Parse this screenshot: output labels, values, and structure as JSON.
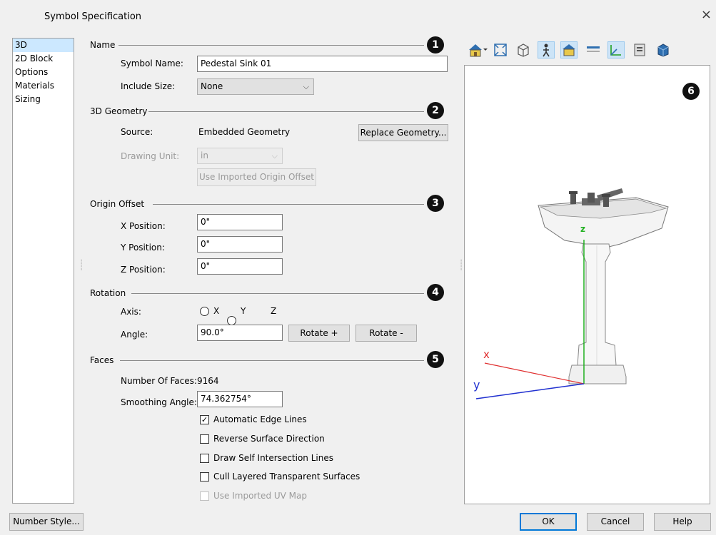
{
  "window": {
    "title": "Symbol Specification",
    "close_glyph": "×"
  },
  "nav": {
    "items": [
      "3D",
      "2D Block",
      "Options",
      "Materials",
      "Sizing"
    ],
    "selected": 0
  },
  "name_group": {
    "label": "Name",
    "badge": "1",
    "symbol_name_label": "Symbol Name:",
    "symbol_name_value": "Pedestal Sink 01",
    "include_size_label": "Include Size:",
    "include_size_value": "None"
  },
  "geometry_group": {
    "label": "3D Geometry",
    "badge": "2",
    "source_label": "Source:",
    "source_value": "Embedded Geometry",
    "replace_button": "Replace Geometry...",
    "drawing_unit_label": "Drawing Unit:",
    "drawing_unit_value": "in",
    "use_origin_button": "Use Imported Origin Offset"
  },
  "origin_group": {
    "label": "Origin Offset",
    "badge": "3",
    "x_label": "X Position:",
    "x_value": "0\"",
    "y_label": "Y Position:",
    "y_value": "0\"",
    "z_label": "Z Position:",
    "z_value": "0\""
  },
  "rotation_group": {
    "label": "Rotation",
    "badge": "4",
    "axis_label": "Axis:",
    "axis_options": [
      "X",
      "Y",
      "Z"
    ],
    "axis_selected": "Z",
    "angle_label": "Angle:",
    "angle_value": "90.0°",
    "rotate_plus": "Rotate +",
    "rotate_minus": "Rotate -"
  },
  "faces_group": {
    "label": "Faces",
    "badge": "5",
    "num_faces_label": "Number Of Faces:",
    "num_faces_value": "9164",
    "smoothing_label": "Smoothing Angle:",
    "smoothing_value": "74.362754°",
    "checks": [
      {
        "label": "Automatic Edge Lines",
        "checked": true,
        "enabled": true
      },
      {
        "label": "Reverse Surface Direction",
        "checked": false,
        "enabled": true
      },
      {
        "label": "Draw Self Intersection Lines",
        "checked": false,
        "enabled": true
      },
      {
        "label": "Cull Layered Transparent Surfaces",
        "checked": false,
        "enabled": true
      },
      {
        "label": "Use Imported UV Map",
        "checked": false,
        "enabled": false
      }
    ]
  },
  "preview": {
    "badge": "6",
    "axis_x": "x",
    "axis_y": "y",
    "axis_z": "z",
    "colors": {
      "x": "#e03030",
      "y": "#2030d0",
      "z": "#20b020"
    },
    "toolbar_icons": [
      "view-camera-icon",
      "fit-view-icon",
      "wireframe-icon",
      "camera-walk-icon",
      "floor-icon",
      "reset-view-icon",
      "axes-icon",
      "layers-icon",
      "solid-box-icon"
    ]
  },
  "footer": {
    "number_style": "Number Style...",
    "ok": "OK",
    "cancel": "Cancel",
    "help": "Help"
  }
}
